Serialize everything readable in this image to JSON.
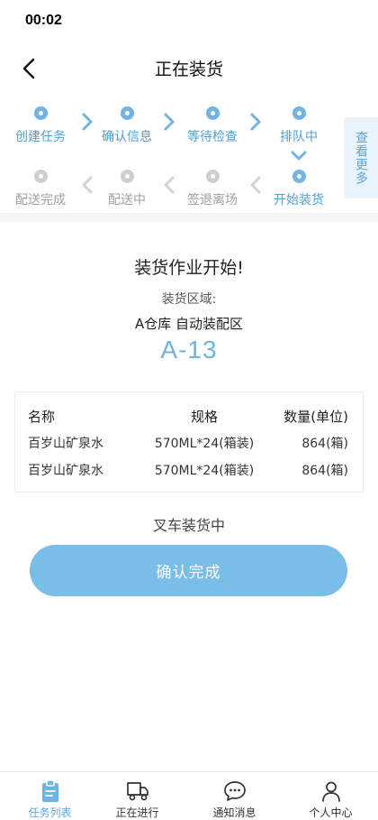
{
  "status_bar": {
    "time": "00:02"
  },
  "nav": {
    "title": "正在装货"
  },
  "steps": {
    "top_row": [
      {
        "label": "创建任务",
        "state": "done"
      },
      {
        "label": "确认信息",
        "state": "done"
      },
      {
        "label": "等待检查",
        "state": "done"
      },
      {
        "label": "排队中",
        "state": "done"
      }
    ],
    "bottom_row": [
      {
        "label": "配送完成",
        "state": "pending"
      },
      {
        "label": "配送中",
        "state": "pending"
      },
      {
        "label": "签退离场",
        "state": "pending"
      },
      {
        "label": "开始装货",
        "state": "current"
      }
    ],
    "see_more": "查看更多"
  },
  "job": {
    "title": "装货作业开始!",
    "area_label": "装货区域:",
    "area_name": "A仓库 自动装配区",
    "area_code": "A-13"
  },
  "goods": {
    "headers": {
      "name": "名称",
      "spec": "规格",
      "qty": "数量(单位)"
    },
    "rows": [
      {
        "name": "百岁山矿泉水",
        "spec": "570ML*24(箱装)",
        "qty": "864(箱)"
      },
      {
        "name": "百岁山矿泉水",
        "spec": "570ML*24(箱装)",
        "qty": "864(箱)"
      }
    ]
  },
  "status_text": "叉车装货中",
  "confirm_label": "确认完成",
  "tabs": [
    {
      "label": "任务列表",
      "icon": "clipboard-icon",
      "selected": true
    },
    {
      "label": "正在进行",
      "icon": "truck-icon",
      "selected": false
    },
    {
      "label": "通知消息",
      "icon": "chat-bubble-icon",
      "selected": false
    },
    {
      "label": "个人中心",
      "icon": "user-icon",
      "selected": false
    }
  ],
  "colors": {
    "accent": "#6fb4e3",
    "inactive": "#cfcfcf",
    "button": "#79bde9"
  }
}
